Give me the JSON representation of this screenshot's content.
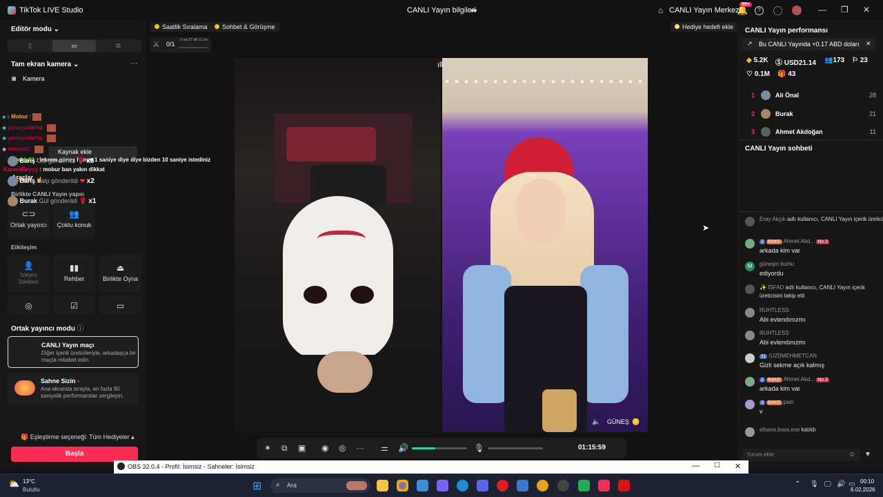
{
  "app": {
    "title": "TikTok LIVE Studio",
    "center_title": "CANLI Yayın bilgileri",
    "home_label": "CANLI Yayın Merkezi",
    "notif_count": "99+"
  },
  "left": {
    "mode_label": "Editör modu",
    "scene_label": "Tam ekran kamera",
    "camera_label": "Kamera",
    "tooltip": "Kaynak ekle",
    "tools_label": "Araçlar",
    "together_label": "Birlikte CANLI Yayın yapın",
    "tiles_together": [
      "Ortak yayıncı",
      "Çoklu konuk"
    ],
    "interaction_label": "Etkileşim",
    "tiles_interaction": [
      "İzleyici Dilekleri",
      "Rehber",
      "Birlikte Oyna"
    ],
    "cohost_label": "Ortak yayıncı modu",
    "card1": {
      "title": "CANLI Yayın maçı",
      "desc": "Diğer içerik üreticileriyle, arkadaşça bir maçta rekabet edin."
    },
    "card2": {
      "title": "Sahne Sizin",
      "desc": "Ana ekranda sırayla, en fazla 90 saniyelik performanslar sergileyin."
    },
    "match_label": "Eşleştirme seçeneği: Tüm Hediyeler",
    "start_label": "Başla"
  },
  "overlay_chat": [
    {
      "user": "Mobur",
      "msg": ""
    },
    {
      "user": "yunusyederhp",
      "msg": ""
    },
    {
      "user": "yunusyederhp",
      "msg": ""
    },
    {
      "user": "lmessi40",
      "msg": ""
    },
    {
      "user": "mindds01",
      "msg": "lekrem güneş hanım 1 saniye diye diye bizden 10 saniye istediniz"
    },
    {
      "user": "KaracaBeyyy",
      "msg": "mobur ban yakın dikkat"
    },
    {
      "user": "Destrolar",
      "msg": ""
    }
  ],
  "top": {
    "chip1": "Saatlik Sıralama",
    "chip2": "Sohbet & Görüşme",
    "goal": "Hediye hedefi ekle",
    "progress": "0/1",
    "timer_small": "2 sa 37 dk 11 sn"
  },
  "video": {
    "right_label": "GÜNEŞ"
  },
  "controls": {
    "time": "01:15:59",
    "volume": 0.42
  },
  "right": {
    "perf_title": "CANLI Yayın performansı",
    "earning_banner": "Bu CANLI Yayında +0.17 ABD doları",
    "stats": {
      "diamonds": "5.2K",
      "usd": "USD21.14",
      "viewers": "173",
      "new_followers": "23",
      "likes": "0.1M",
      "gifters": "43"
    },
    "ranking": [
      {
        "rank": "1",
        "name": "Ali Önal",
        "score": "28"
      },
      {
        "rank": "2",
        "name": "Burak",
        "score": "21"
      },
      {
        "rank": "3",
        "name": "Ahmet Akdoğan",
        "score": "11"
      }
    ],
    "chat_title": "CANLI Yayın sohbeti",
    "gifts": [
      {
        "user": "Barış",
        "action": "Gül gönderildi",
        "mult": "x8"
      },
      {
        "user": "Barış",
        "action": "Kalp gönderildi",
        "mult": "x2"
      },
      {
        "user": "Burak",
        "action": "Gül gönderildi",
        "mult": "x1"
      }
    ],
    "chat": [
      {
        "user": "Eray Akçık",
        "msg": "adlı kullanıcı, CANLI Yayın içerik üreticisini takip etti"
      },
      {
        "user": "Ahmet Akd...",
        "msg": "arkada kim var"
      },
      {
        "user": "güneşin bumu",
        "msg": "ediyordu"
      },
      {
        "user": "İSFAD",
        "msg": "adlı kullanıcı, CANLI Yayın içerik üreticisini takip etti"
      },
      {
        "user": "RUHTLESS",
        "msg": "Abi evlendınızmı"
      },
      {
        "user": "RUHTLESS",
        "msg": "Abi evlendınızmı"
      },
      {
        "user": "(UZİ)MEHMETCAN",
        "msg": "Gizli sekme açık kalmış"
      },
      {
        "user": "Ahmet Akd...",
        "msg": "arkada kim var"
      },
      {
        "user": "pain",
        "msg": "v"
      },
      {
        "user": "efsane.boss.exe",
        "msg": "katıldı"
      }
    ],
    "chat_placeholder": "Yorum ekle",
    "badges": {
      "b2": "2",
      "bake": "BAKE",
      "no3": "No.3",
      "b11": "11",
      "b3": "3"
    }
  },
  "obs": {
    "title": "OBS 32.0.4 - Profil: İsimsiz - Sahneler: İsimsiz"
  },
  "taskbar": {
    "temp": "13°C",
    "weather": "Bulutlu",
    "search": "Ara",
    "time": "00:10",
    "date": "6.02.2026"
  }
}
